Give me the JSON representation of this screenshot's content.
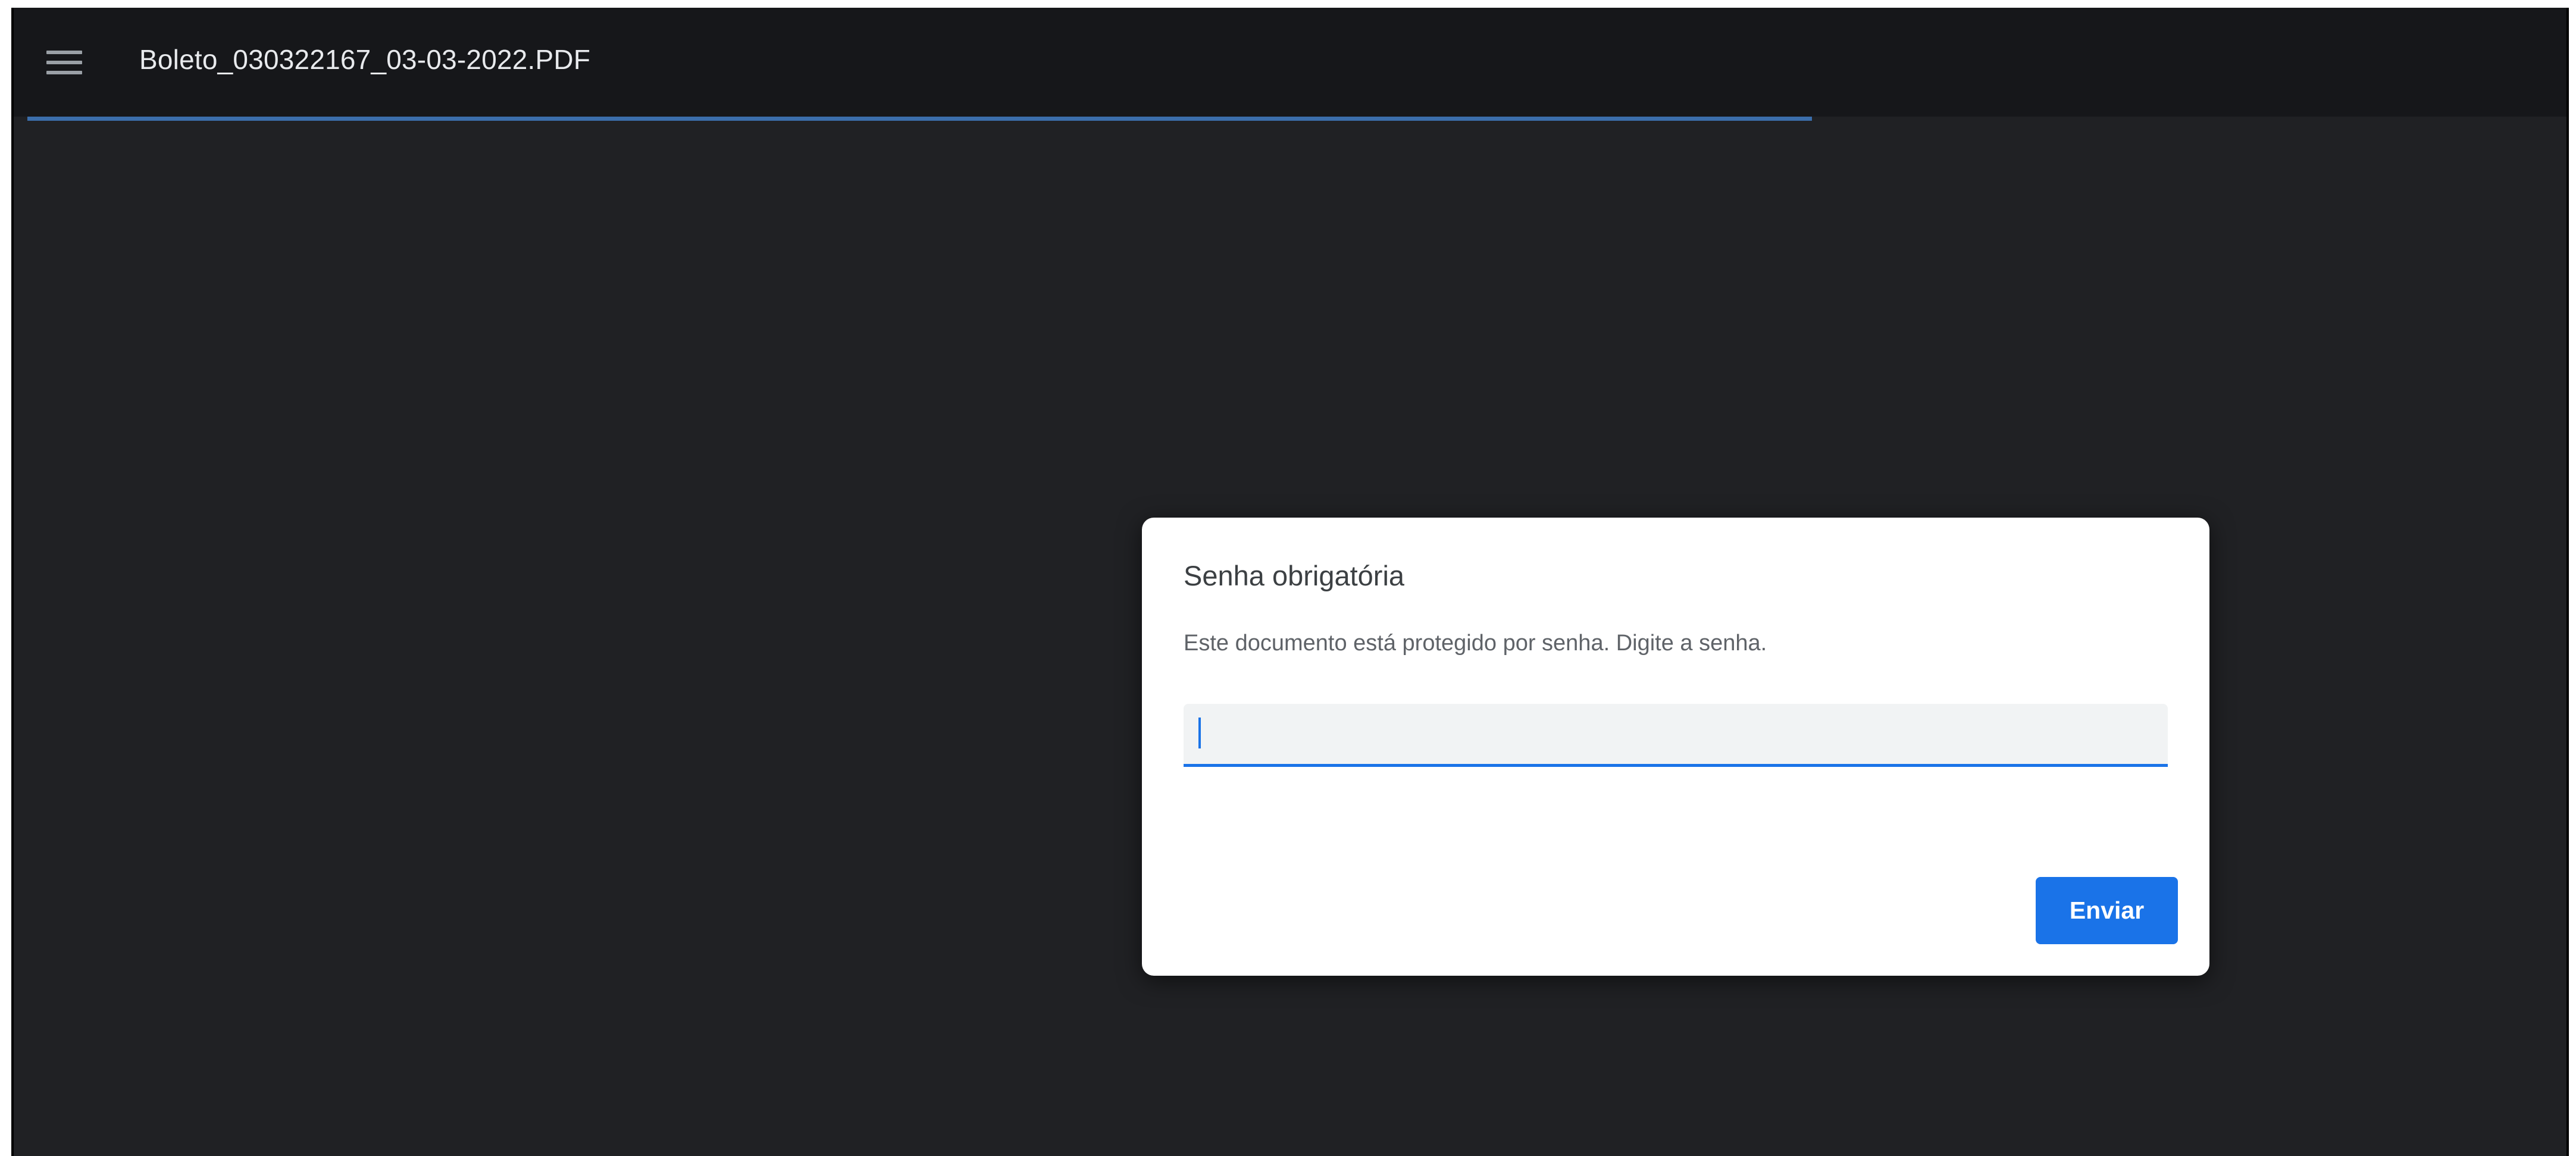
{
  "toolbar": {
    "menu_icon": "hamburger-menu-icon",
    "document_title": "Boleto_030322167_03-03-2022.PDF"
  },
  "dialog": {
    "title": "Senha obrigatória",
    "message": "Este documento está protegido por senha. Digite a senha.",
    "password_value": "",
    "password_placeholder": "",
    "submit_label": "Enviar"
  },
  "colors": {
    "toolbar_bg": "#16171a",
    "viewer_bg": "#202124",
    "accent": "#1a73e8",
    "progress": "#3b6eab"
  }
}
